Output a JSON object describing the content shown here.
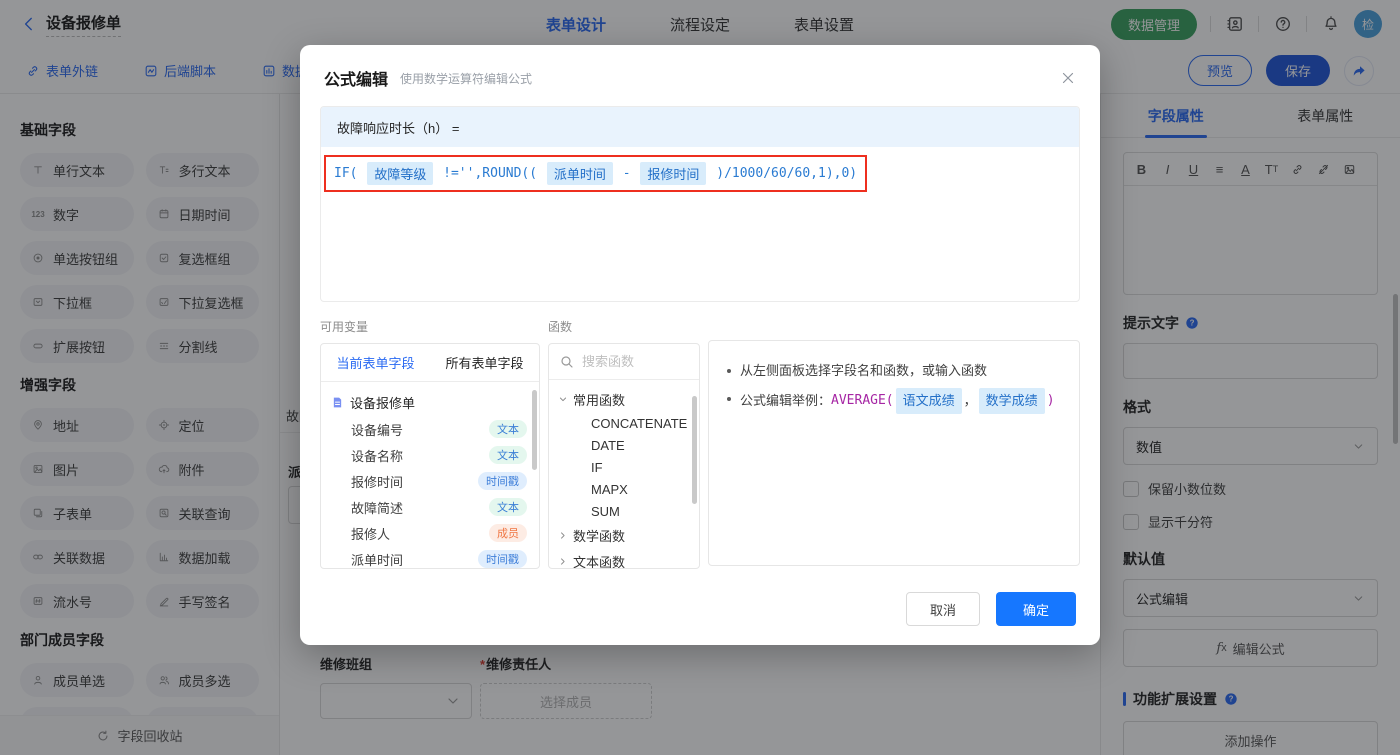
{
  "topbar": {
    "back_title": "设备报修单",
    "tabs": [
      {
        "label": "表单设计",
        "cls": "active"
      },
      {
        "label": "流程设定",
        "cls": ""
      },
      {
        "label": "表单设置",
        "cls": ""
      }
    ],
    "data_manage_label": "数据管理",
    "avatar_text": "检"
  },
  "subbar": {
    "links": [
      {
        "icon": "link-icon",
        "label": "表单外链"
      },
      {
        "icon": "script-icon",
        "label": "后端脚本"
      },
      {
        "icon": "data-auth-icon",
        "label": "数据权"
      }
    ],
    "preview_label": "预览",
    "save_label": "保存"
  },
  "sidebar": {
    "sections": [
      {
        "title": "基础字段"
      },
      {
        "title": "增强字段"
      },
      {
        "title": "部门成员字段"
      }
    ],
    "basic_items": [
      {
        "icon": "text-icon",
        "label": "单行文本"
      },
      {
        "icon": "multitext-icon",
        "label": "多行文本"
      },
      {
        "icon": "number-icon",
        "label": "数字"
      },
      {
        "icon": "datetime-icon",
        "label": "日期时间"
      },
      {
        "icon": "radio-icon",
        "label": "单选按钮组"
      },
      {
        "icon": "checkbox-icon",
        "label": "复选框组"
      },
      {
        "icon": "select-icon",
        "label": "下拉框"
      },
      {
        "icon": "multiselect-icon",
        "label": "下拉复选框"
      },
      {
        "icon": "button-icon",
        "label": "扩展按钮"
      },
      {
        "icon": "divider-icon",
        "label": "分割线"
      }
    ],
    "enhanced_items": [
      {
        "icon": "address-icon",
        "label": "地址"
      },
      {
        "icon": "location-icon",
        "label": "定位"
      },
      {
        "icon": "image-icon",
        "label": "图片"
      },
      {
        "icon": "attachment-icon",
        "label": "附件"
      },
      {
        "icon": "subform-icon",
        "label": "子表单"
      },
      {
        "icon": "lookup-icon",
        "label": "关联查询"
      },
      {
        "icon": "linkdata-icon",
        "label": "关联数据"
      },
      {
        "icon": "dataload-icon",
        "label": "数据加载"
      },
      {
        "icon": "serial-icon",
        "label": "流水号"
      },
      {
        "icon": "signature-icon",
        "label": "手写签名"
      }
    ],
    "member_items": [
      {
        "icon": "person-icon",
        "label": "成员单选"
      },
      {
        "icon": "persons-icon",
        "label": "成员多选"
      }
    ],
    "recycle_label": "字段回收站"
  },
  "canvas": {
    "partial_text_a": "故障",
    "partial_text_b": "派",
    "repair_team_label": "维修班组",
    "responsible_label": "维修责任人",
    "required_mark": "*",
    "choose_member_label": "选择成员"
  },
  "modal": {
    "title": "公式编辑",
    "subtitle": "使用数学运算符编辑公式",
    "formula_target": "故障响应时长（h） =",
    "formula_segments": [
      {
        "cls": "seg-code",
        "text": "IF( "
      },
      {
        "cls": "seg-field",
        "text": "故障等级"
      },
      {
        "cls": "seg-code",
        "text": " !='',ROUND(( "
      },
      {
        "cls": "seg-field",
        "text": "派单时间"
      },
      {
        "cls": "seg-code",
        "text": " - "
      },
      {
        "cls": "seg-field",
        "text": "报修时间"
      },
      {
        "cls": "seg-code",
        "text": " )/1000/60/60,1),0)"
      }
    ],
    "variables": {
      "label": "可用变量",
      "tabs": [
        {
          "label": "当前表单字段",
          "cls": "active"
        },
        {
          "label": "所有表单字段",
          "cls": ""
        }
      ],
      "root_label": "设备报修单",
      "fields": [
        {
          "name": "设备编号",
          "type": "文本",
          "cls": "b-green"
        },
        {
          "name": "设备名称",
          "type": "文本",
          "cls": "b-green"
        },
        {
          "name": "报修时间",
          "type": "时间戳",
          "cls": "b-blue"
        },
        {
          "name": "故障简述",
          "type": "文本",
          "cls": "b-green"
        },
        {
          "name": "报修人",
          "type": "成员",
          "cls": "b-orange"
        },
        {
          "name": "派单时间",
          "type": "时间戳",
          "cls": "b-blue"
        }
      ]
    },
    "functions": {
      "label": "函数",
      "search_placeholder": "搜索函数",
      "nodes": [
        {
          "caret": "caret-down-icon",
          "label": "常用函数",
          "cls": "fn-group"
        },
        {
          "caret": "",
          "label": "CONCATENATE",
          "cls": "fn-item"
        },
        {
          "caret": "",
          "label": "DATE",
          "cls": "fn-item"
        },
        {
          "caret": "",
          "label": "IF",
          "cls": "fn-item"
        },
        {
          "caret": "",
          "label": "MAPX",
          "cls": "fn-item"
        },
        {
          "caret": "",
          "label": "SUM",
          "cls": "fn-item"
        },
        {
          "caret": "caret-right-icon",
          "label": "数学函数",
          "cls": "fn-group"
        },
        {
          "caret": "caret-right-icon",
          "label": "文本函数",
          "cls": "fn-group"
        }
      ]
    },
    "tips": {
      "line1": "从左侧面板选择字段名和函数，或输入函数",
      "example_segments": [
        {
          "cls": "seg-plain",
          "text": "公式编辑举例："
        },
        {
          "cls": "seg-func",
          "text": "AVERAGE("
        },
        {
          "cls": "seg-field",
          "text": "语文成绩"
        },
        {
          "cls": "seg-plain",
          "text": "，"
        },
        {
          "cls": "seg-field",
          "text": "数学成绩"
        },
        {
          "cls": "seg-func",
          "text": ")"
        }
      ]
    },
    "cancel_label": "取消",
    "ok_label": "确定"
  },
  "rightpanel": {
    "tabs": [
      {
        "label": "字段属性",
        "cls": "active"
      },
      {
        "label": "表单属性",
        "cls": ""
      }
    ],
    "toolbar_icons": [
      {
        "icon": "bold-icon"
      },
      {
        "icon": "italic-icon"
      },
      {
        "icon": "underline-icon"
      },
      {
        "icon": "align-icon"
      },
      {
        "icon": "font-color-icon"
      },
      {
        "icon": "font-size-icon"
      },
      {
        "icon": "insert-link-icon"
      },
      {
        "icon": "remove-link-icon"
      },
      {
        "icon": "insert-image-icon"
      }
    ],
    "hint_label": "提示文字",
    "format_label": "格式",
    "format_value": "数值",
    "checkbox_labels": [
      {
        "label": "保留小数位数"
      },
      {
        "label": "显示千分符"
      }
    ],
    "default_label": "默认值",
    "default_value": "公式编辑",
    "edit_formula_label": "编辑公式",
    "ext_label": "功能扩展设置",
    "add_action_label": "添加操作"
  },
  "colors": {
    "accent_blue": "#2a6af2",
    "ok_blue": "#1677ff",
    "save_blue": "#1f56d9",
    "green": "#3aa05f",
    "formula_blue": "#2a7bd2",
    "token_bg": "#d8ecfb",
    "red_highlight": "#ee2f1f",
    "func_purple": "#a626a4"
  }
}
